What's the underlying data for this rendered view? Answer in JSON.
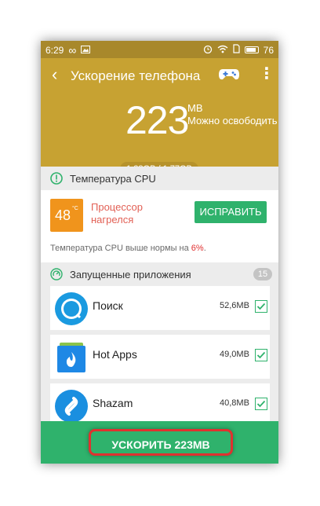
{
  "status_bar": {
    "time": "6:29",
    "battery": "76",
    "icons": [
      "infinity-icon",
      "image-icon",
      "alarm-icon",
      "wifi-icon",
      "sim-icon",
      "battery-icon"
    ]
  },
  "header": {
    "back_icon": "‹",
    "title": "Ускорение телефона",
    "gamepad_icon": "gamepad-icon",
    "menu_icon": "more-vert-icon",
    "free_amount": "223",
    "free_unit": "MB",
    "free_label": "Можно освободить",
    "memory_usage": "1.28GB / 1.77GB"
  },
  "cpu_section": {
    "title": "Температура CPU",
    "temp_value": "48",
    "temp_unit": "°C",
    "warning_line1": "Процессор",
    "warning_line2": "нагрелся",
    "fix_button": "ИСПРАВИТЬ",
    "note_prefix": "Температура CPU выше нормы на ",
    "note_percent": "6%",
    "note_suffix": "."
  },
  "apps_section": {
    "title": "Запущенные приложения",
    "count": "15",
    "apps": [
      {
        "name": "Поиск",
        "size": "52,6MB",
        "checked": true
      },
      {
        "name": "Hot Apps",
        "size": "49,0MB",
        "checked": true
      },
      {
        "name": "Shazam",
        "size": "40,8MB",
        "checked": true
      }
    ]
  },
  "boost_button": "УСКОРИТЬ 223MB",
  "colors": {
    "header": "#c7a232",
    "status": "#a8882b",
    "accent_green": "#2fb26c",
    "warning_red": "#e26055",
    "highlight": "#e0312f"
  }
}
